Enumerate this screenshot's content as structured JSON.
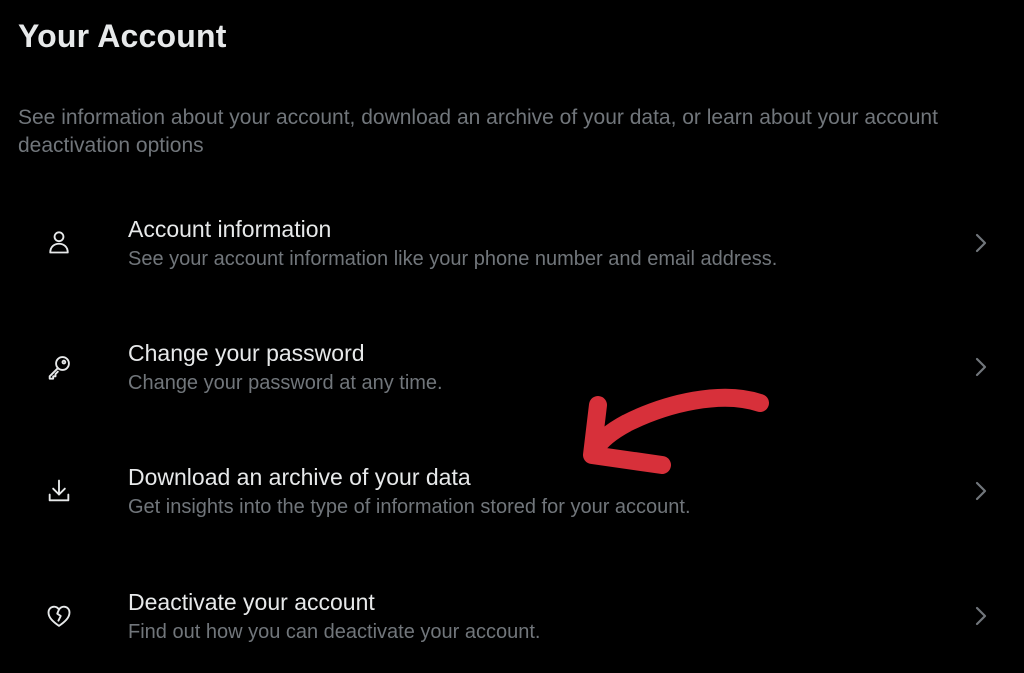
{
  "page": {
    "title": "Your Account",
    "description": "See information about your account, download an archive of your data, or learn about your account deactivation options"
  },
  "menu": {
    "items": [
      {
        "icon": "person-icon",
        "title": "Account information",
        "subtitle": "See your account information like your phone number and email address."
      },
      {
        "icon": "key-icon",
        "title": "Change your password",
        "subtitle": "Change your password at any time."
      },
      {
        "icon": "download-icon",
        "title": "Download an archive of your data",
        "subtitle": "Get insights into the type of information stored for your account."
      },
      {
        "icon": "broken-heart-icon",
        "title": "Deactivate your account",
        "subtitle": "Find out how you can deactivate your account."
      }
    ]
  },
  "annotation": {
    "icon": "red-arrow-icon",
    "color": "#d7303a"
  },
  "colors": {
    "background": "#000000",
    "primary_text": "#e7e9ea",
    "secondary_text": "#71767b",
    "icon": "#e7e9ea",
    "chevron": "#71767b"
  }
}
